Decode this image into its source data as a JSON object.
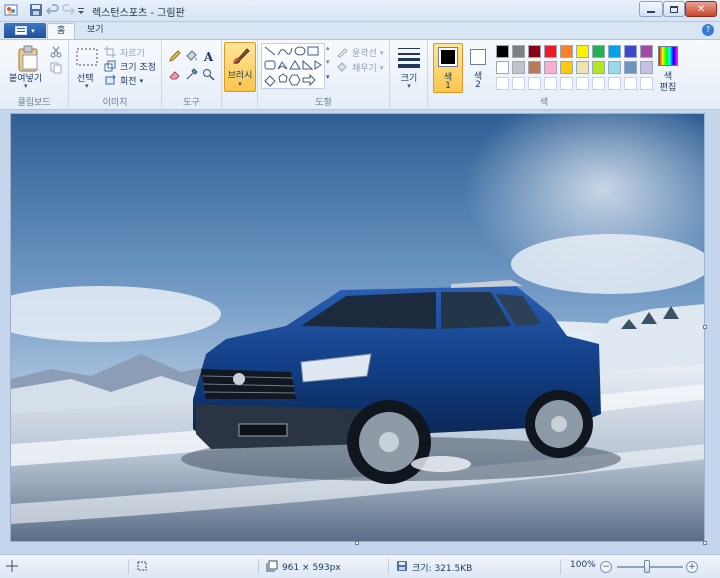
{
  "window": {
    "title": "렉스턴스포츠 - 그림판"
  },
  "tabs": {
    "file": "",
    "home": "홈",
    "view": "보기"
  },
  "ribbon": {
    "clipboard": {
      "paste": "붙여넣기",
      "label": "클립보드"
    },
    "image": {
      "select": "선택",
      "crop": "자르기",
      "resize": "크기 조정",
      "rotate": "회전",
      "label": "이미지"
    },
    "tools": {
      "label": "도구"
    },
    "brushes": {
      "label": "브러시"
    },
    "shapes": {
      "outline": "윤곽선",
      "fill": "채우기",
      "label": "도형"
    },
    "size": {
      "label": "크기"
    },
    "colors": {
      "color1": "색",
      "color1_num": "1",
      "color2": "색",
      "color2_num": "2",
      "edit": "색",
      "edit2": "편집",
      "label": "색",
      "color1_value": "#000000",
      "color2_value": "#ffffff",
      "palette_row1": [
        "#000000",
        "#7f7f7f",
        "#880015",
        "#ed1c24",
        "#ff7f27",
        "#fff200",
        "#22b14c",
        "#00a2e8",
        "#3f48cc",
        "#a349a4"
      ],
      "palette_row2": [
        "#ffffff",
        "#c3c3c3",
        "#b97a57",
        "#ffaec9",
        "#ffc90e",
        "#efe4b0",
        "#b5e61d",
        "#99d9ea",
        "#7092be",
        "#c8bfe7"
      ]
    }
  },
  "status": {
    "dimensions": "961 × 593px",
    "filesize": "크기: 321.5KB",
    "zoom": "100%"
  }
}
